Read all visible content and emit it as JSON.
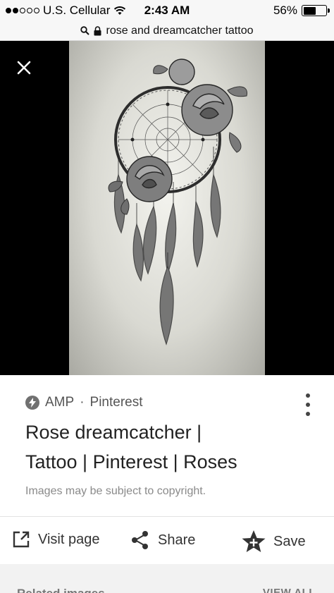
{
  "status_bar": {
    "carrier": "U.S. Cellular",
    "time": "2:43 AM",
    "battery": "56%",
    "battery_level": 0.56,
    "signal_bars": 2,
    "signal_total": 5
  },
  "url_bar": {
    "query": "rose and dreamcatcher tattoo",
    "icons": [
      "search-icon",
      "lock-icon"
    ]
  },
  "viewer": {
    "close_icon": "close-icon",
    "background_color": "#000000"
  },
  "result": {
    "source_badge": "AMP",
    "separator": "·",
    "source": "Pinterest",
    "title_line1": "Rose dreamcatcher |",
    "title_line2": "Tattoo | Pinterest | Roses",
    "copyright_note": "Images may be subject to copyright."
  },
  "actions": {
    "visit": "Visit page",
    "share": "Share",
    "save": "Save"
  },
  "related": {
    "title": "Related images",
    "view_all": "VIEW ALL"
  }
}
